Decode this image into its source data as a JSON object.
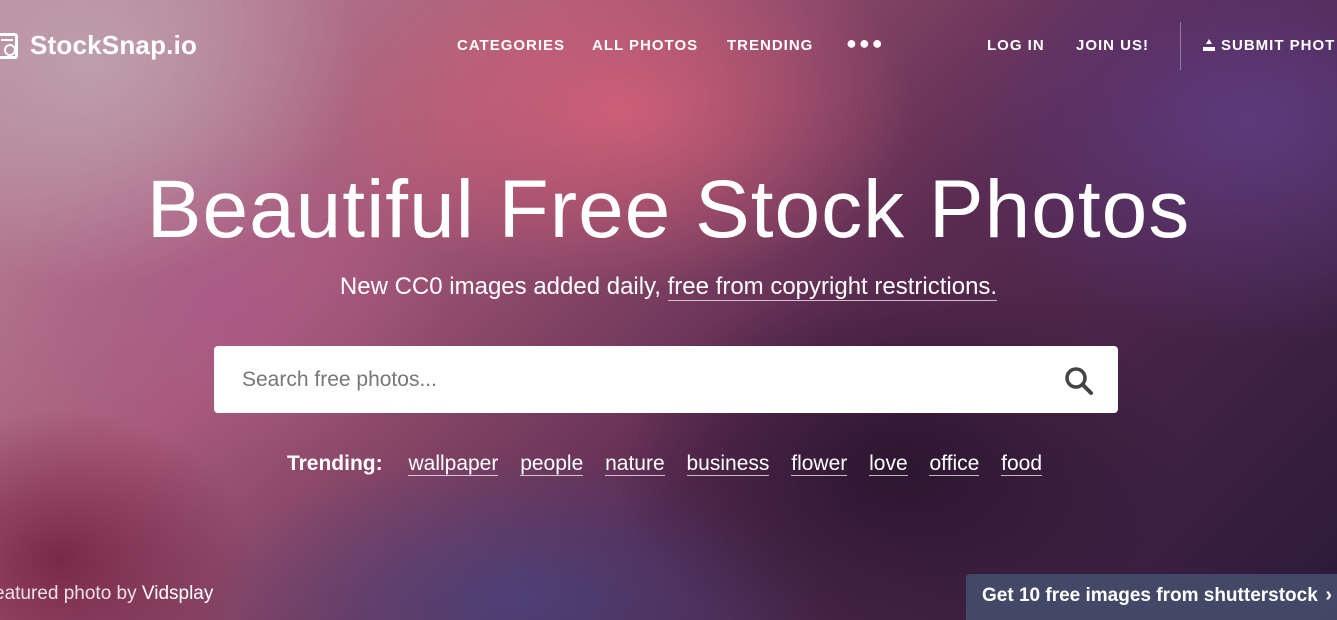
{
  "nav": {
    "logo_text": "StockSnap.io",
    "links": [
      "CATEGORIES",
      "ALL PHOTOS",
      "TRENDING"
    ],
    "more_icon": "ellipsis-icon",
    "login": "LOG IN",
    "join": "JOIN US!",
    "submit": "SUBMIT PHOT"
  },
  "hero": {
    "title": "Beautiful Free Stock Photos",
    "subtitle_plain": "New CC0 images added daily,",
    "subtitle_link": "free from copyright restrictions."
  },
  "search": {
    "placeholder": "Search free photos...",
    "icon": "search-icon"
  },
  "trending": {
    "label": "Trending:",
    "tags": [
      "wallpaper",
      "people",
      "nature",
      "business",
      "flower",
      "love",
      "office",
      "food"
    ]
  },
  "footer": {
    "featured_prefix": "eatured photo by",
    "featured_author": "Vidsplay",
    "promo_text": "Get 10 free images from shutterstock",
    "promo_icon": "chevron-right-icon"
  }
}
